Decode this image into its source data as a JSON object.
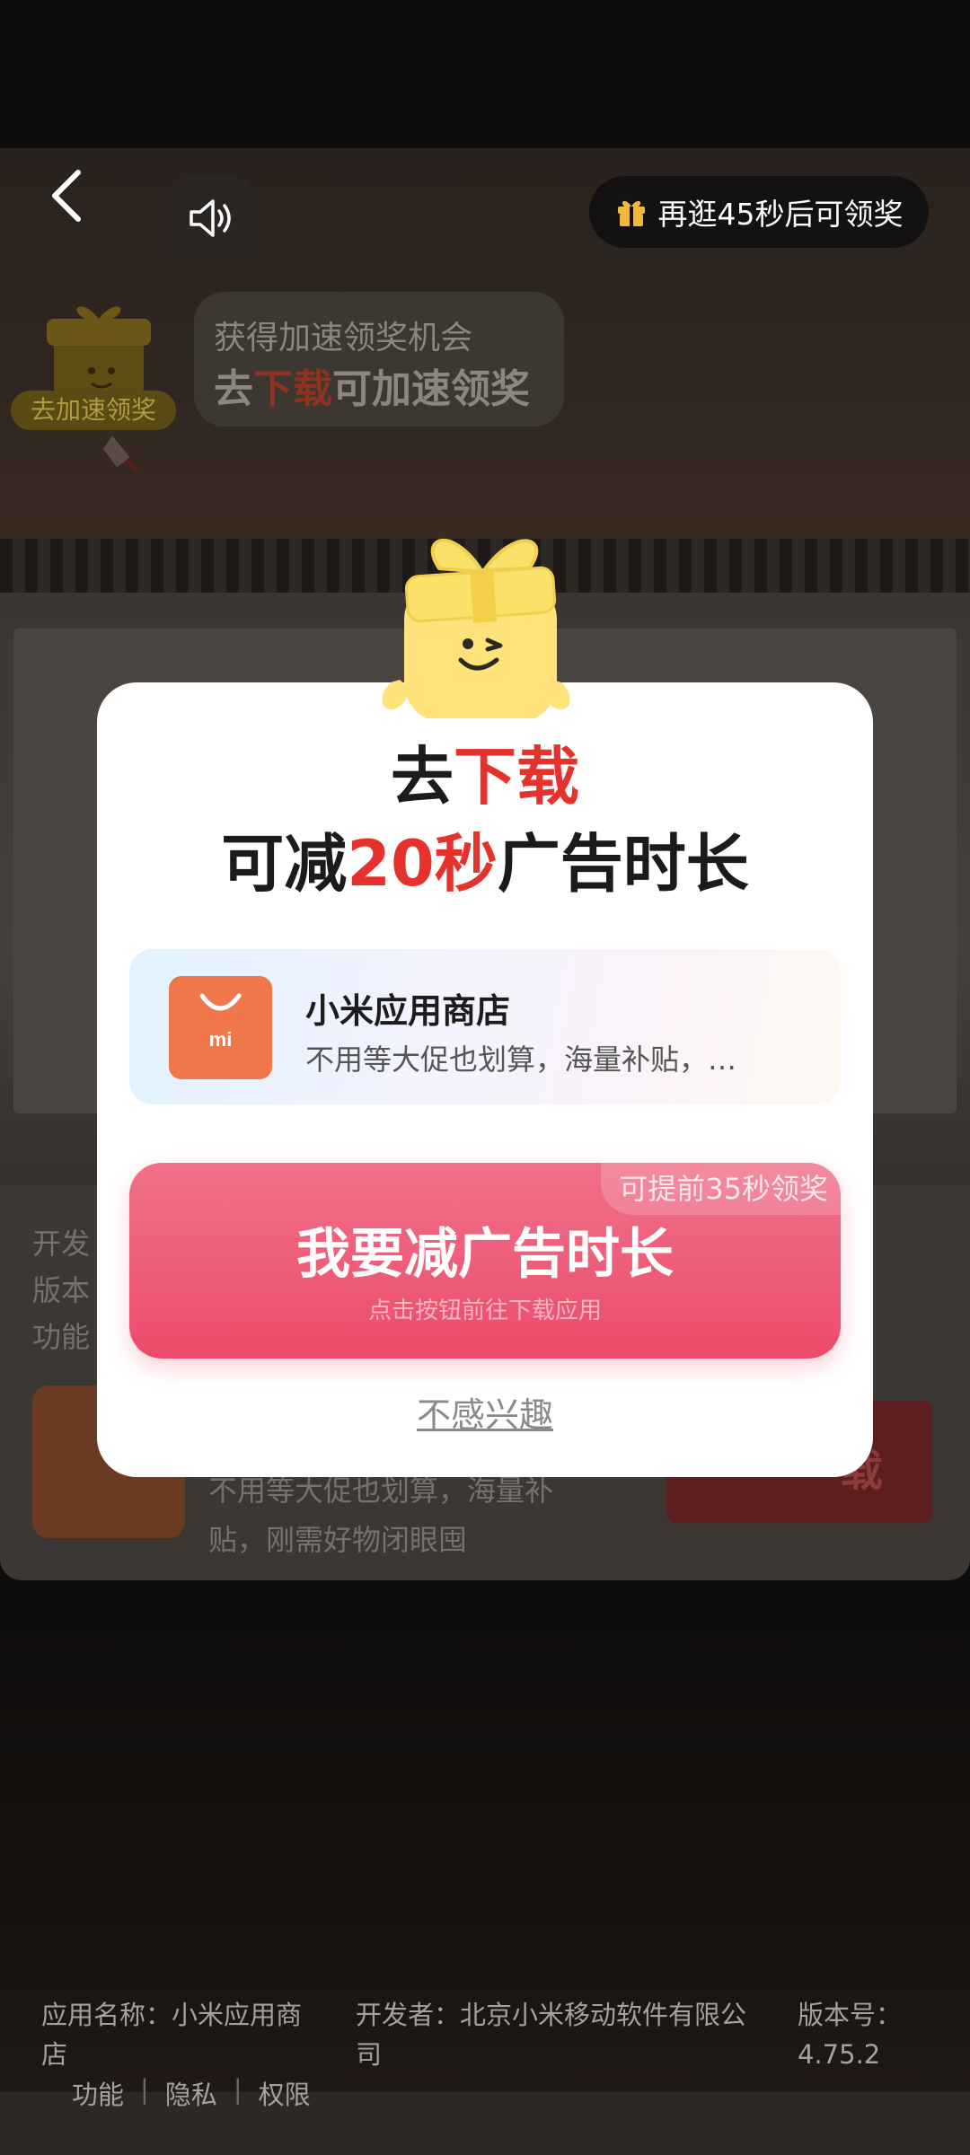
{
  "top_bar": {
    "back_icon": "back-arrow-icon",
    "sound_icon": "speaker-icon",
    "timer_text": "再逛45秒后可领奖",
    "timer_icon": "gift-icon"
  },
  "speedup": {
    "mascot_label": "去加速领奖",
    "line1": "获得加速领奖机会",
    "line2_prefix": "去",
    "line2_highlight": "下载",
    "line2_suffix": "可加速领奖"
  },
  "modal": {
    "title_line1_prefix": "去",
    "title_line1_highlight": "下载",
    "title_line2_prefix": "可减",
    "title_line2_highlight": "20秒",
    "title_line2_suffix": "广告时长",
    "app": {
      "name": "小米应用商店",
      "description": "不用等大促也划算，海量补贴，…",
      "icon_text": "mi"
    },
    "cta": {
      "badge": "可提前35秒领奖",
      "label": "我要减广告时长",
      "sublabel": "点击按钮前往下载应用"
    },
    "dismiss": "不感兴趣"
  },
  "background": {
    "card_lines": [
      "开发",
      "版本",
      "功能"
    ],
    "card_desc_line1": "不用等大促也划算，海量补",
    "card_desc_line2": "贴，刚需好物闭眼囤",
    "download_label": "载"
  },
  "footer": {
    "app_name": "应用名称：小米应用商店",
    "developer": "开发者：北京小米移动软件有限公司",
    "version": "版本号：4.75.2",
    "links": [
      "功能",
      "隐私",
      "权限"
    ]
  },
  "colors": {
    "accent_red": "#e5322d",
    "cta_pink": "#ec4b69",
    "app_icon_orange": "#f0774a"
  }
}
